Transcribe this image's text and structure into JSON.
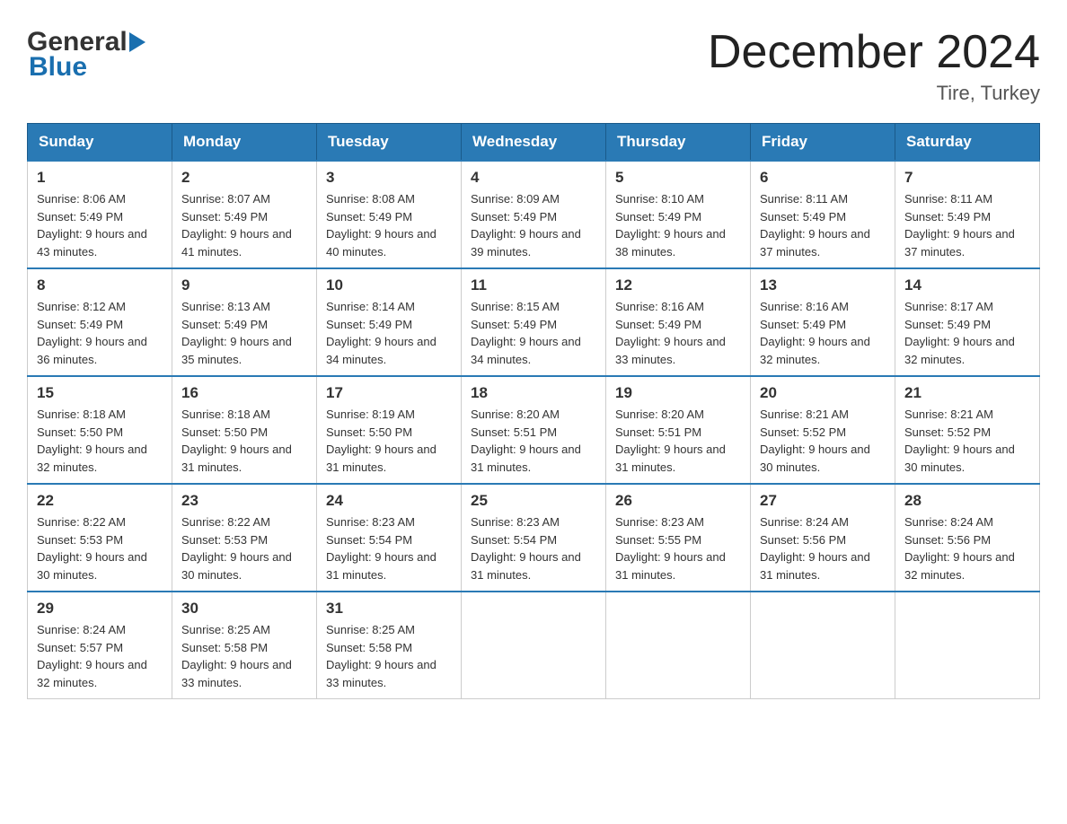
{
  "header": {
    "logo": {
      "general": "General",
      "triangle": "▶",
      "blue": "Blue"
    },
    "title": "December 2024",
    "location": "Tire, Turkey"
  },
  "days_of_week": [
    "Sunday",
    "Monday",
    "Tuesday",
    "Wednesday",
    "Thursday",
    "Friday",
    "Saturday"
  ],
  "weeks": [
    [
      {
        "day": "1",
        "sunrise": "Sunrise: 8:06 AM",
        "sunset": "Sunset: 5:49 PM",
        "daylight": "Daylight: 9 hours and 43 minutes."
      },
      {
        "day": "2",
        "sunrise": "Sunrise: 8:07 AM",
        "sunset": "Sunset: 5:49 PM",
        "daylight": "Daylight: 9 hours and 41 minutes."
      },
      {
        "day": "3",
        "sunrise": "Sunrise: 8:08 AM",
        "sunset": "Sunset: 5:49 PM",
        "daylight": "Daylight: 9 hours and 40 minutes."
      },
      {
        "day": "4",
        "sunrise": "Sunrise: 8:09 AM",
        "sunset": "Sunset: 5:49 PM",
        "daylight": "Daylight: 9 hours and 39 minutes."
      },
      {
        "day": "5",
        "sunrise": "Sunrise: 8:10 AM",
        "sunset": "Sunset: 5:49 PM",
        "daylight": "Daylight: 9 hours and 38 minutes."
      },
      {
        "day": "6",
        "sunrise": "Sunrise: 8:11 AM",
        "sunset": "Sunset: 5:49 PM",
        "daylight": "Daylight: 9 hours and 37 minutes."
      },
      {
        "day": "7",
        "sunrise": "Sunrise: 8:11 AM",
        "sunset": "Sunset: 5:49 PM",
        "daylight": "Daylight: 9 hours and 37 minutes."
      }
    ],
    [
      {
        "day": "8",
        "sunrise": "Sunrise: 8:12 AM",
        "sunset": "Sunset: 5:49 PM",
        "daylight": "Daylight: 9 hours and 36 minutes."
      },
      {
        "day": "9",
        "sunrise": "Sunrise: 8:13 AM",
        "sunset": "Sunset: 5:49 PM",
        "daylight": "Daylight: 9 hours and 35 minutes."
      },
      {
        "day": "10",
        "sunrise": "Sunrise: 8:14 AM",
        "sunset": "Sunset: 5:49 PM",
        "daylight": "Daylight: 9 hours and 34 minutes."
      },
      {
        "day": "11",
        "sunrise": "Sunrise: 8:15 AM",
        "sunset": "Sunset: 5:49 PM",
        "daylight": "Daylight: 9 hours and 34 minutes."
      },
      {
        "day": "12",
        "sunrise": "Sunrise: 8:16 AM",
        "sunset": "Sunset: 5:49 PM",
        "daylight": "Daylight: 9 hours and 33 minutes."
      },
      {
        "day": "13",
        "sunrise": "Sunrise: 8:16 AM",
        "sunset": "Sunset: 5:49 PM",
        "daylight": "Daylight: 9 hours and 32 minutes."
      },
      {
        "day": "14",
        "sunrise": "Sunrise: 8:17 AM",
        "sunset": "Sunset: 5:49 PM",
        "daylight": "Daylight: 9 hours and 32 minutes."
      }
    ],
    [
      {
        "day": "15",
        "sunrise": "Sunrise: 8:18 AM",
        "sunset": "Sunset: 5:50 PM",
        "daylight": "Daylight: 9 hours and 32 minutes."
      },
      {
        "day": "16",
        "sunrise": "Sunrise: 8:18 AM",
        "sunset": "Sunset: 5:50 PM",
        "daylight": "Daylight: 9 hours and 31 minutes."
      },
      {
        "day": "17",
        "sunrise": "Sunrise: 8:19 AM",
        "sunset": "Sunset: 5:50 PM",
        "daylight": "Daylight: 9 hours and 31 minutes."
      },
      {
        "day": "18",
        "sunrise": "Sunrise: 8:20 AM",
        "sunset": "Sunset: 5:51 PM",
        "daylight": "Daylight: 9 hours and 31 minutes."
      },
      {
        "day": "19",
        "sunrise": "Sunrise: 8:20 AM",
        "sunset": "Sunset: 5:51 PM",
        "daylight": "Daylight: 9 hours and 31 minutes."
      },
      {
        "day": "20",
        "sunrise": "Sunrise: 8:21 AM",
        "sunset": "Sunset: 5:52 PM",
        "daylight": "Daylight: 9 hours and 30 minutes."
      },
      {
        "day": "21",
        "sunrise": "Sunrise: 8:21 AM",
        "sunset": "Sunset: 5:52 PM",
        "daylight": "Daylight: 9 hours and 30 minutes."
      }
    ],
    [
      {
        "day": "22",
        "sunrise": "Sunrise: 8:22 AM",
        "sunset": "Sunset: 5:53 PM",
        "daylight": "Daylight: 9 hours and 30 minutes."
      },
      {
        "day": "23",
        "sunrise": "Sunrise: 8:22 AM",
        "sunset": "Sunset: 5:53 PM",
        "daylight": "Daylight: 9 hours and 30 minutes."
      },
      {
        "day": "24",
        "sunrise": "Sunrise: 8:23 AM",
        "sunset": "Sunset: 5:54 PM",
        "daylight": "Daylight: 9 hours and 31 minutes."
      },
      {
        "day": "25",
        "sunrise": "Sunrise: 8:23 AM",
        "sunset": "Sunset: 5:54 PM",
        "daylight": "Daylight: 9 hours and 31 minutes."
      },
      {
        "day": "26",
        "sunrise": "Sunrise: 8:23 AM",
        "sunset": "Sunset: 5:55 PM",
        "daylight": "Daylight: 9 hours and 31 minutes."
      },
      {
        "day": "27",
        "sunrise": "Sunrise: 8:24 AM",
        "sunset": "Sunset: 5:56 PM",
        "daylight": "Daylight: 9 hours and 31 minutes."
      },
      {
        "day": "28",
        "sunrise": "Sunrise: 8:24 AM",
        "sunset": "Sunset: 5:56 PM",
        "daylight": "Daylight: 9 hours and 32 minutes."
      }
    ],
    [
      {
        "day": "29",
        "sunrise": "Sunrise: 8:24 AM",
        "sunset": "Sunset: 5:57 PM",
        "daylight": "Daylight: 9 hours and 32 minutes."
      },
      {
        "day": "30",
        "sunrise": "Sunrise: 8:25 AM",
        "sunset": "Sunset: 5:58 PM",
        "daylight": "Daylight: 9 hours and 33 minutes."
      },
      {
        "day": "31",
        "sunrise": "Sunrise: 8:25 AM",
        "sunset": "Sunset: 5:58 PM",
        "daylight": "Daylight: 9 hours and 33 minutes."
      },
      null,
      null,
      null,
      null
    ]
  ]
}
